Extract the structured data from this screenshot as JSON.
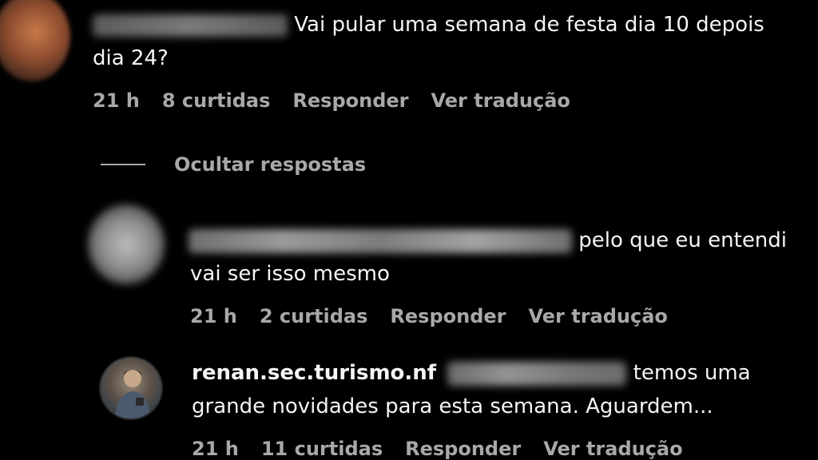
{
  "comments": [
    {
      "text_line1": "Vai pular uma semana de festa dia 10 depois",
      "text_line2": "dia 24?",
      "time": "21 h",
      "likes": "8 curtidas",
      "reply": "Responder",
      "translate": "Ver tradução"
    },
    {
      "text_line1": "pelo que eu entendi",
      "text_line2": "vai ser isso mesmo",
      "time": "21 h",
      "likes": "2 curtidas",
      "reply": "Responder",
      "translate": "Ver tradução"
    },
    {
      "username": "renan.sec.turismo.nf",
      "text_line1": "temos uma",
      "text_line2": "grande novidades para esta semana. Aguardem...",
      "time": "21 h",
      "likes": "11 curtidas",
      "reply": "Responder",
      "translate": "Ver tradução"
    }
  ],
  "hide_replies": "Ocultar respostas",
  "colors": {
    "background": "#000000",
    "text": "#f5f5f5",
    "muted": "#a8a8a8"
  }
}
